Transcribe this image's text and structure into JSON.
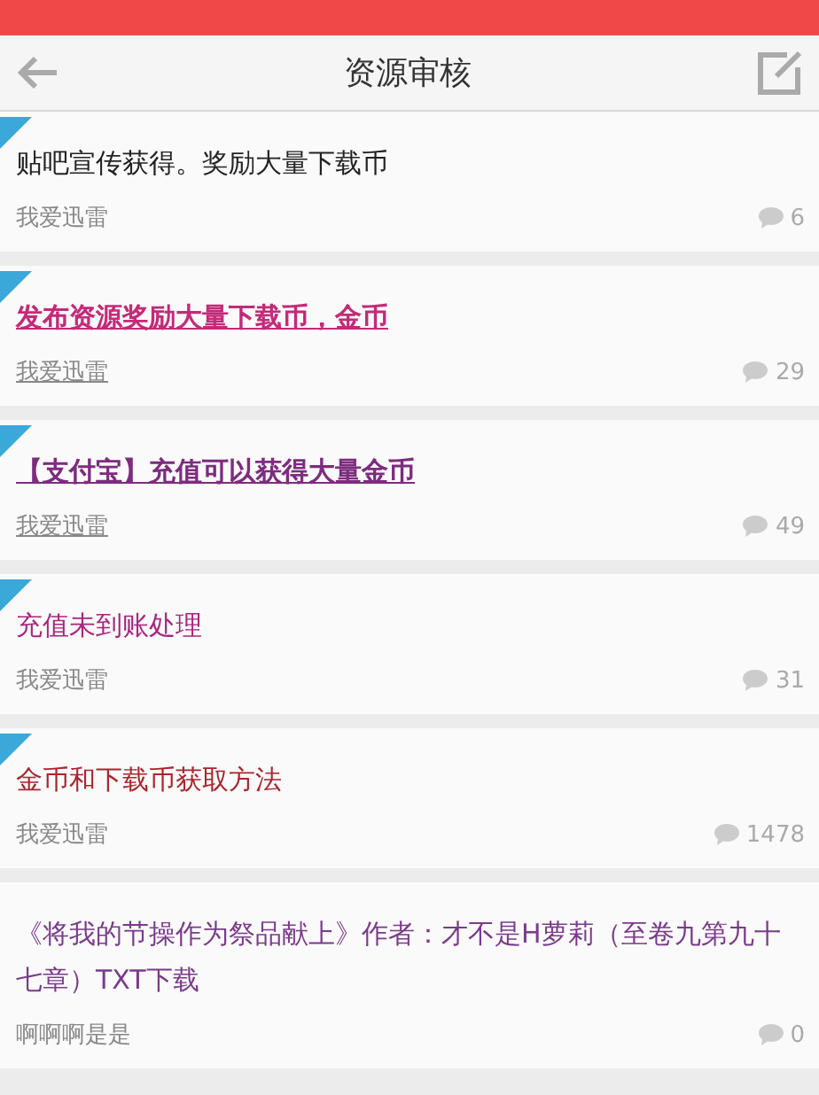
{
  "header": {
    "title": "资源审核"
  },
  "posts": [
    {
      "title": "贴吧宣传获得。奖励大量下载币",
      "color": "#222222",
      "underlined": false,
      "pinned": true,
      "author": "我爱迅雷",
      "comments": "6"
    },
    {
      "title": "发布资源奖励大量下载币，金币",
      "color": "#c42a78",
      "underlined": true,
      "pinned": true,
      "author": "我爱迅雷",
      "comments": "29"
    },
    {
      "title": "【支付宝】充值可以获得大量金币",
      "color": "#7d2c7f",
      "underlined": true,
      "pinned": true,
      "author": "我爱迅雷",
      "comments": "49"
    },
    {
      "title": "充值未到账处理",
      "color": "#a8267e",
      "underlined": false,
      "pinned": true,
      "author": "我爱迅雷",
      "comments": "31"
    },
    {
      "title": "金币和下载币获取方法",
      "color": "#a8262c",
      "underlined": false,
      "pinned": true,
      "author": "我爱迅雷",
      "comments": "1478"
    },
    {
      "title": "《将我的节操作为祭品献上》作者：才不是H萝莉（至卷九第九十七章）TXT下载",
      "color": "#7a3a8a",
      "underlined": false,
      "pinned": false,
      "author": "啊啊啊是是",
      "comments": "0"
    }
  ]
}
